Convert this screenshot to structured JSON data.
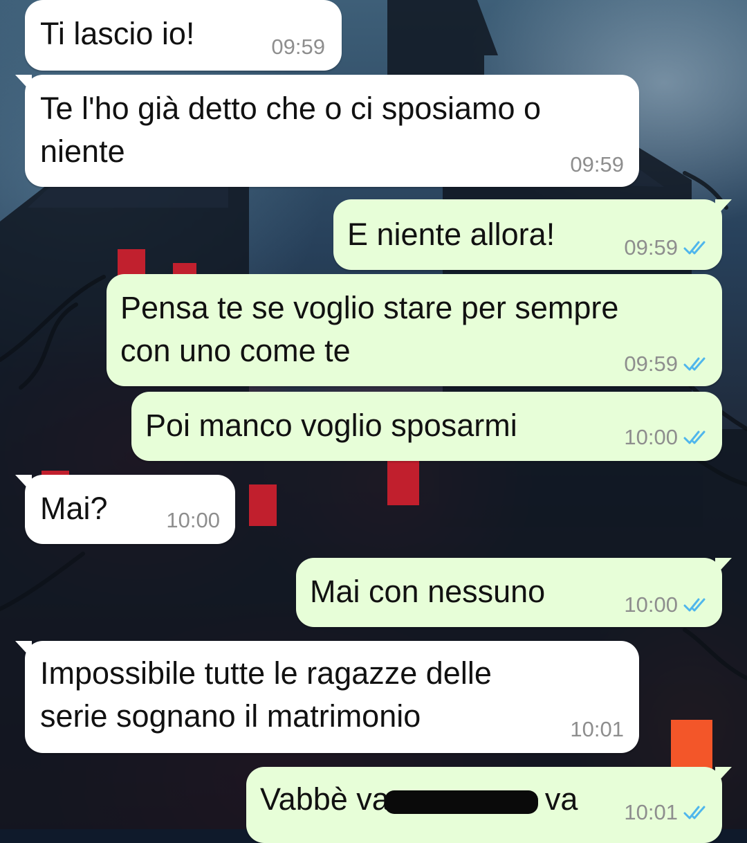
{
  "messages": [
    {
      "direction": "incoming",
      "text": "Ti lascio io!",
      "time": "09:59"
    },
    {
      "direction": "incoming",
      "text": "Te l'ho già detto che o ci sposiamo o\nniente",
      "time": "09:59"
    },
    {
      "direction": "outgoing",
      "text": "E niente allora!",
      "time": "09:59",
      "status": "read"
    },
    {
      "direction": "outgoing",
      "text": "Pensa te se voglio stare per sempre\ncon uno come te",
      "time": "09:59",
      "status": "read"
    },
    {
      "direction": "outgoing",
      "text": "Poi manco voglio sposarmi",
      "time": "10:00",
      "status": "read"
    },
    {
      "direction": "incoming",
      "text": "Mai?",
      "time": "10:00"
    },
    {
      "direction": "outgoing",
      "text": "Mai con nessuno",
      "time": "10:00",
      "status": "read"
    },
    {
      "direction": "incoming",
      "text": "Impossibile tutte le ragazze delle\nserie sognano il matrimonio",
      "time": "10:01"
    },
    {
      "direction": "outgoing",
      "text": "Vabbè va                  va",
      "time": "10:01",
      "status": "read"
    }
  ],
  "colors": {
    "incoming_bubble": "#ffffff",
    "outgoing_bubble": "#e7fed8",
    "read_ticks": "#4fb6ec",
    "timestamp": "#8e8e8e"
  },
  "icons": {
    "read_status": "double-check-icon"
  }
}
